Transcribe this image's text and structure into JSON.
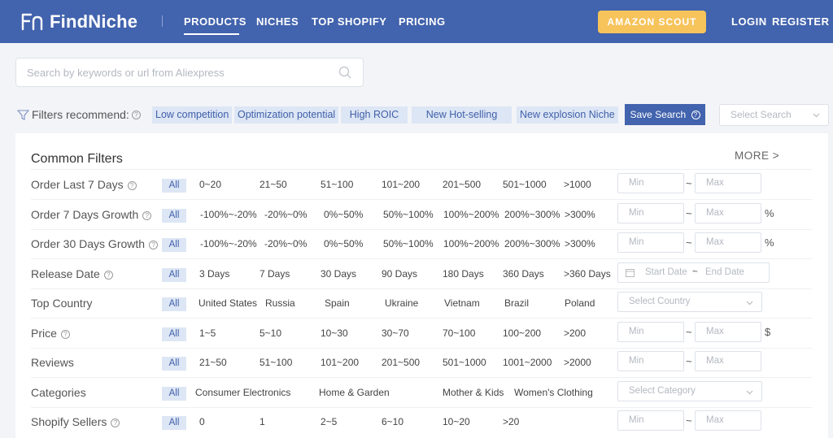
{
  "header": {
    "logo_text": "FindNiche",
    "nav": [
      "PRODUCTS",
      "NICHES",
      "TOP SHOPIFY",
      "PRICING"
    ],
    "amazon_button": "AMAZON SCOUT",
    "login": "LOGIN",
    "register": "REGISTER"
  },
  "search": {
    "placeholder": "Search by keywords or url from Aliexpress"
  },
  "recommend": {
    "label": "Filters recommend:",
    "tags": [
      "Low competition",
      "Optimization potential",
      "High ROIC",
      "New Hot-selling",
      "New explosion Niche"
    ],
    "save_button": "Save Search",
    "select_placeholder": "Select Search"
  },
  "filters": {
    "title": "Common Filters",
    "more": "MORE >",
    "all_label": "All",
    "min_placeholder": "Min",
    "max_placeholder": "Max",
    "tilde": "~",
    "rows": [
      {
        "label": "Order Last 7 Days",
        "options": [
          "0~20",
          "21~50",
          "51~100",
          "101~200",
          "201~500",
          "501~1000",
          ">1000"
        ],
        "unit": ""
      },
      {
        "label": "Order 7 Days Growth",
        "options": [
          "-100%~-20%",
          "-20%~0%",
          "0%~50%",
          "50%~100%",
          "100%~200%",
          "200%~300%",
          ">300%"
        ],
        "unit": "%"
      },
      {
        "label": "Order 30 Days Growth",
        "options": [
          "-100%~-20%",
          "-20%~0%",
          "0%~50%",
          "50%~100%",
          "100%~200%",
          "200%~300%",
          ">300%"
        ],
        "unit": "%"
      },
      {
        "label": "Release Date",
        "options": [
          "3 Days",
          "7 Days",
          "30 Days",
          "90 Days",
          "180 Days",
          "360 Days",
          ">360 Days"
        ],
        "start_placeholder": "Start Date",
        "end_placeholder": "End Date"
      },
      {
        "label": "Top Country",
        "options": [
          "United States",
          "Russia",
          "Spain",
          "Ukraine",
          "Vietnam",
          "Brazil",
          "Poland"
        ],
        "select_placeholder": "Select Country"
      },
      {
        "label": "Price",
        "options": [
          "1~5",
          "5~10",
          "10~30",
          "30~70",
          "70~100",
          "100~200",
          ">200"
        ],
        "unit": "$"
      },
      {
        "label": "Reviews",
        "options": [
          "21~50",
          "51~100",
          "101~200",
          "201~500",
          "501~1000",
          "1001~2000",
          ">2000"
        ],
        "unit": ""
      },
      {
        "label": "Categories",
        "options": [
          "Consumer Electronics",
          "Home & Garden",
          "Mother & Kids",
          "Women's Clothing"
        ],
        "select_placeholder": "Select Category"
      },
      {
        "label": "Shopify Sellers",
        "options": [
          "0",
          "1",
          "2~5",
          "6~10",
          "10~20",
          ">20"
        ],
        "unit": ""
      }
    ]
  },
  "colors": {
    "header_bg": "#4263ad",
    "accent_yellow": "#f7c35b",
    "tag_bg": "#dde6f5",
    "tag_text": "#3f5fa8"
  },
  "icons": {
    "search": "search-icon",
    "filter": "funnel-icon",
    "help": "question-icon",
    "dropdown": "chevron-down-icon",
    "calendar": "calendar-icon"
  }
}
